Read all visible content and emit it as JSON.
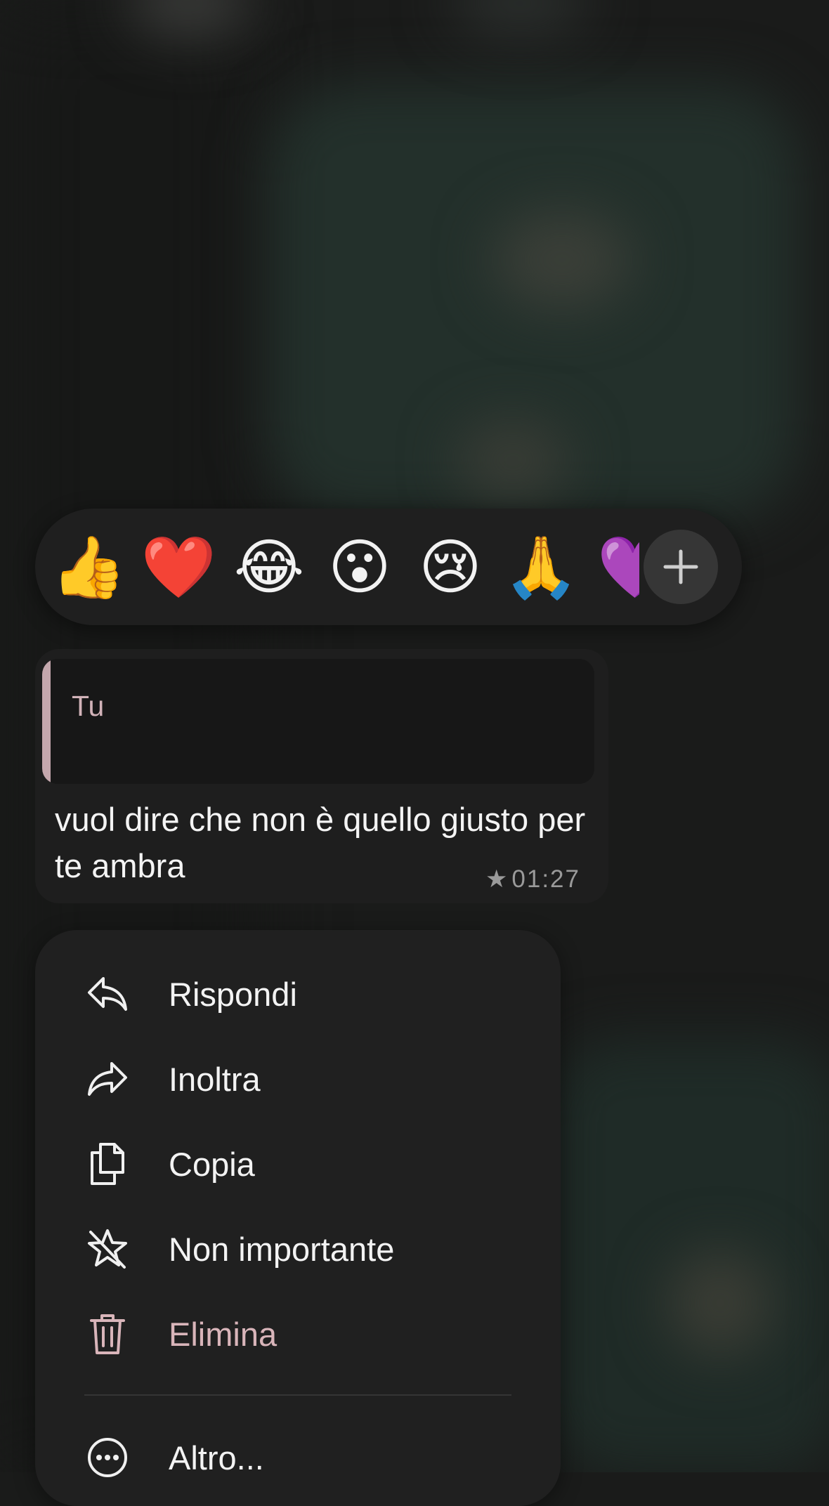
{
  "reactions": {
    "emojis": [
      {
        "name": "thumbs-up",
        "glyph": "👍"
      },
      {
        "name": "heart",
        "glyph": "❤️"
      },
      {
        "name": "tears-of-joy",
        "glyph": "😂"
      },
      {
        "name": "surprised",
        "glyph": "😮"
      },
      {
        "name": "crying",
        "glyph": "😢"
      },
      {
        "name": "praying-hands",
        "glyph": "🙏"
      },
      {
        "name": "purple-heart",
        "glyph": "💜"
      }
    ],
    "more_icon": "plus-icon"
  },
  "message": {
    "quote_author": "Tu",
    "text": "vuol dire che non è quello giusto per te ambra",
    "starred": true,
    "star_glyph": "★",
    "time": "01:27"
  },
  "menu": {
    "items": [
      {
        "label": "Rispondi",
        "icon": "reply-icon"
      },
      {
        "label": "Inoltra",
        "icon": "forward-icon"
      },
      {
        "label": "Copia",
        "icon": "copy-icon"
      },
      {
        "label": "Non importante",
        "icon": "unstar-icon"
      },
      {
        "label": "Elimina",
        "icon": "trash-icon",
        "color": "#d9b5ba"
      },
      {
        "label": "Altro...",
        "icon": "more-icon"
      }
    ]
  }
}
